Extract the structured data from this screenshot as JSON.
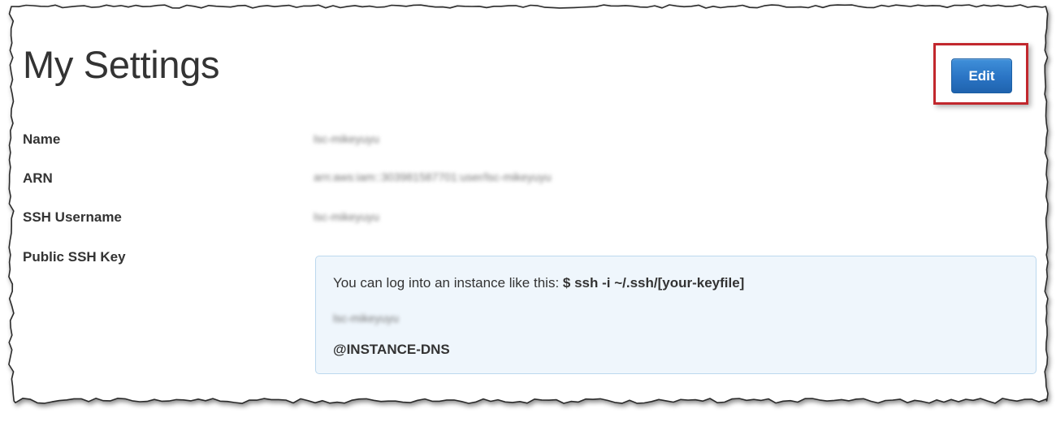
{
  "page": {
    "title": "My Settings"
  },
  "toolbar": {
    "edit_label": "Edit"
  },
  "fields": {
    "name": {
      "label": "Name",
      "value": "lsc-mikeyuyu"
    },
    "arn": {
      "label": "ARN",
      "value": "arn:aws:iam::303981587701:user/lsc-mikeyuyu"
    },
    "ssh_username": {
      "label": "SSH Username",
      "value": "lsc-mikeyuyu"
    },
    "public_ssh_key": {
      "label": "Public SSH Key"
    }
  },
  "ssh_info": {
    "hint_text": "You can log into an instance like this: ",
    "command": "$ ssh -i ~/.ssh/[your-keyfile]",
    "user": "lsc-mikeyuyu",
    "dns": "@INSTANCE-DNS"
  },
  "colors": {
    "highlight_border": "#c1272d",
    "button_blue": "#2a74c4",
    "info_box_bg": "#eff6fc",
    "info_box_border": "#bcd8ee",
    "text": "#333333"
  }
}
